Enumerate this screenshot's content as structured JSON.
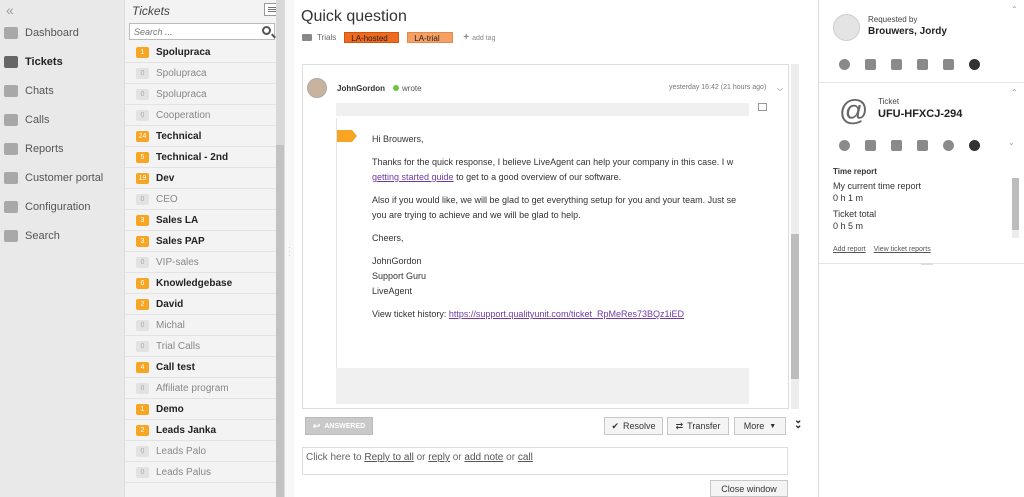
{
  "nav": {
    "collapse_glyph": "«",
    "items": [
      {
        "label": "Dashboard",
        "icon": "dashboard-icon"
      },
      {
        "label": "Tickets",
        "icon": "envelope-icon"
      },
      {
        "label": "Chats",
        "icon": "chat-icon"
      },
      {
        "label": "Calls",
        "icon": "phone-icon"
      },
      {
        "label": "Reports",
        "icon": "reports-icon"
      },
      {
        "label": "Customer portal",
        "icon": "portal-icon"
      },
      {
        "label": "Configuration",
        "icon": "gear-icon"
      },
      {
        "label": "Search",
        "icon": "search-icon"
      }
    ],
    "active": "Tickets"
  },
  "ticket_list": {
    "title": "Tickets",
    "search_placeholder": "Search ...",
    "departments": [
      {
        "count": "1",
        "name": "Spolupraca",
        "bold": true
      },
      {
        "count": "0",
        "name": "Spolupraca",
        "bold": false
      },
      {
        "count": "0",
        "name": "Spolupraca",
        "bold": false
      },
      {
        "count": "0",
        "name": "Cooperation",
        "bold": false
      },
      {
        "count": "24",
        "name": "Technical",
        "bold": true
      },
      {
        "count": "5",
        "name": "Technical - 2nd",
        "bold": true
      },
      {
        "count": "19",
        "name": "Dev",
        "bold": true
      },
      {
        "count": "0",
        "name": "CEO",
        "bold": false
      },
      {
        "count": "3",
        "name": "Sales LA",
        "bold": true
      },
      {
        "count": "3",
        "name": "Sales PAP",
        "bold": true
      },
      {
        "count": "0",
        "name": "VIP-sales",
        "bold": false
      },
      {
        "count": "6",
        "name": "Knowledgebase",
        "bold": true
      },
      {
        "count": "2",
        "name": "David",
        "bold": true
      },
      {
        "count": "0",
        "name": "Michal",
        "bold": false
      },
      {
        "count": "0",
        "name": "Trial Calls",
        "bold": false
      },
      {
        "count": "4",
        "name": "Call test",
        "bold": true
      },
      {
        "count": "0",
        "name": "Affiliate program",
        "bold": false
      },
      {
        "count": "1",
        "name": "Demo",
        "bold": true
      },
      {
        "count": "2",
        "name": "Leads Janka",
        "bold": true
      },
      {
        "count": "0",
        "name": "Leads Palo",
        "bold": false
      },
      {
        "count": "0",
        "name": "Leads Palus",
        "bold": false
      }
    ]
  },
  "ticket": {
    "subject": "Quick question",
    "folder": "Trials",
    "tags": [
      "LA-hosted",
      "LA-trial"
    ],
    "add_tag": "add tag"
  },
  "message": {
    "author": "JohnGordon",
    "verb": "wrote",
    "time": "yesterday 16:42 (21 hours ago)",
    "greeting": "Hi Brouwers,",
    "p1_line1": "Thanks for the quick response, I believe LiveAgent can help your company in this case. I w",
    "p1_link": "getting started guide",
    "p1_line2_rest": " to get to a good overview of our software.",
    "p2_line1": "Also if you would like, we will be glad to get everything setup for you and your team. Just se",
    "p2_line2": "you are trying to achieve and we will be glad to help.",
    "closing": "Cheers,",
    "sig1": "JohnGordon",
    "sig2": "Support Guru",
    "sig3": "LiveAgent",
    "history_label": "View ticket history: ",
    "history_link": "https://support.qualityunit.com/ticket_RpMeRes73BQz1iED"
  },
  "actions": {
    "answered": "ANSWERED",
    "resolve": "Resolve",
    "transfer": "Transfer",
    "more": "More"
  },
  "reply": {
    "prefix": "Click here to ",
    "reply_all": "Reply to all",
    "or1": " or ",
    "reply": "reply",
    "or2": " or ",
    "add_note": "add note",
    "or3": " or ",
    "call": "call"
  },
  "close_window": "Close window",
  "right_panel": {
    "requested_label": "Requested by",
    "requester": "Brouwers, Jordy",
    "ticket_label": "Ticket",
    "ticket_id": "UFU-HFXCJ-294",
    "at_glyph": "@",
    "time_report_title": "Time report",
    "entries": [
      {
        "name": "My current time report",
        "value": "0 h 1 m"
      },
      {
        "name": "Ticket total",
        "value": "0 h 5 m"
      }
    ],
    "add_report": "Add report",
    "view_reports": "View ticket reports"
  },
  "colors": {
    "accent_orange": "#f6a623",
    "tag_hosted": "#ef6a1f",
    "tag_trial": "#f7a064",
    "link_purple": "#6f3aa5",
    "online_green": "#6cc24a"
  }
}
